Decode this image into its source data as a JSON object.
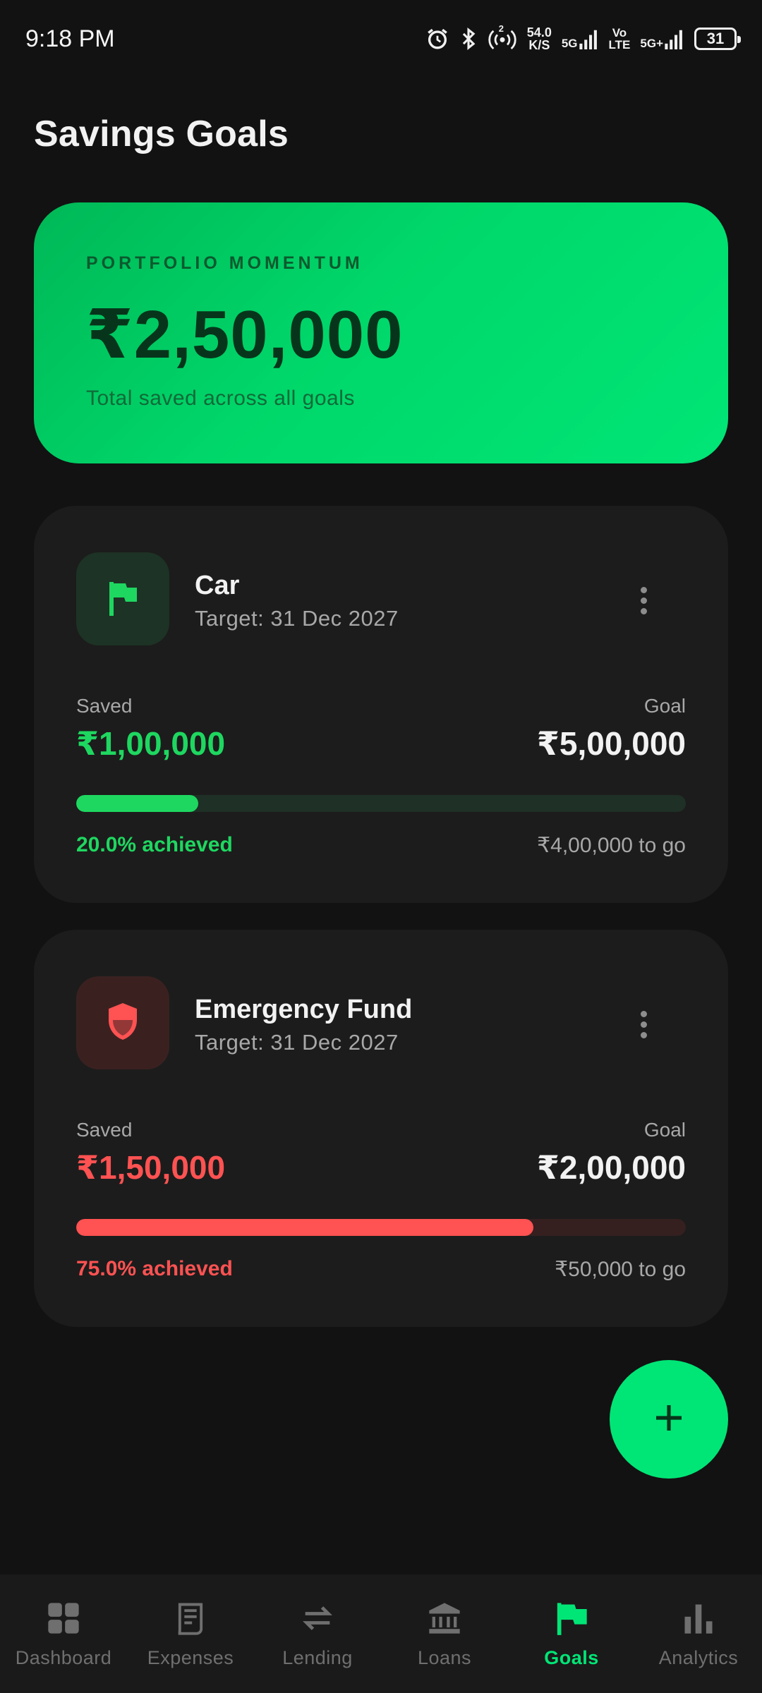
{
  "status_bar": {
    "time": "9:18 PM",
    "net_speed_value": "54.0",
    "net_speed_unit": "K/S",
    "hotspot_count": "2",
    "signal1_label": "5G",
    "volte_top": "Vo",
    "volte_bottom": "LTE",
    "signal2_label": "5G+",
    "battery": "31"
  },
  "page": {
    "title": "Savings Goals"
  },
  "hero": {
    "kicker": "PORTFOLIO MOMENTUM",
    "amount": "₹2,50,000",
    "subtitle": "Total saved across all goals"
  },
  "goals": [
    {
      "name": "Car",
      "target": "Target: 31 Dec 2027",
      "icon": "flag-icon",
      "saved_label": "Saved",
      "goal_label": "Goal",
      "saved": "₹1,00,000",
      "goal": "₹5,00,000",
      "progress": 0.2,
      "percent_text": "20.0% achieved",
      "to_go": "₹4,00,000 to go",
      "accent": "#1ed760",
      "icon_bg": "#1d3325",
      "track": "#1f3026"
    },
    {
      "name": "Emergency Fund",
      "target": "Target: 31 Dec 2027",
      "icon": "shield-icon",
      "saved_label": "Saved",
      "goal_label": "Goal",
      "saved": "₹1,50,000",
      "goal": "₹2,00,000",
      "progress": 0.75,
      "percent_text": "75.0% achieved",
      "to_go": "₹50,000 to go",
      "accent": "#ff5252",
      "icon_bg": "#3a2120",
      "track": "#351f1f"
    }
  ],
  "fab": {
    "icon": "plus-icon"
  },
  "nav": {
    "items": [
      {
        "label": "Dashboard",
        "icon": "dashboard-icon"
      },
      {
        "label": "Expenses",
        "icon": "receipt-icon"
      },
      {
        "label": "Lending",
        "icon": "swap-icon"
      },
      {
        "label": "Loans",
        "icon": "bank-icon"
      },
      {
        "label": "Goals",
        "icon": "flag-icon",
        "active": true
      },
      {
        "label": "Analytics",
        "icon": "bar-chart-icon"
      }
    ]
  },
  "colors": {
    "background": "#121212",
    "card": "#1c1c1c",
    "brand_green": "#00e676",
    "danger_red": "#ff5252"
  }
}
